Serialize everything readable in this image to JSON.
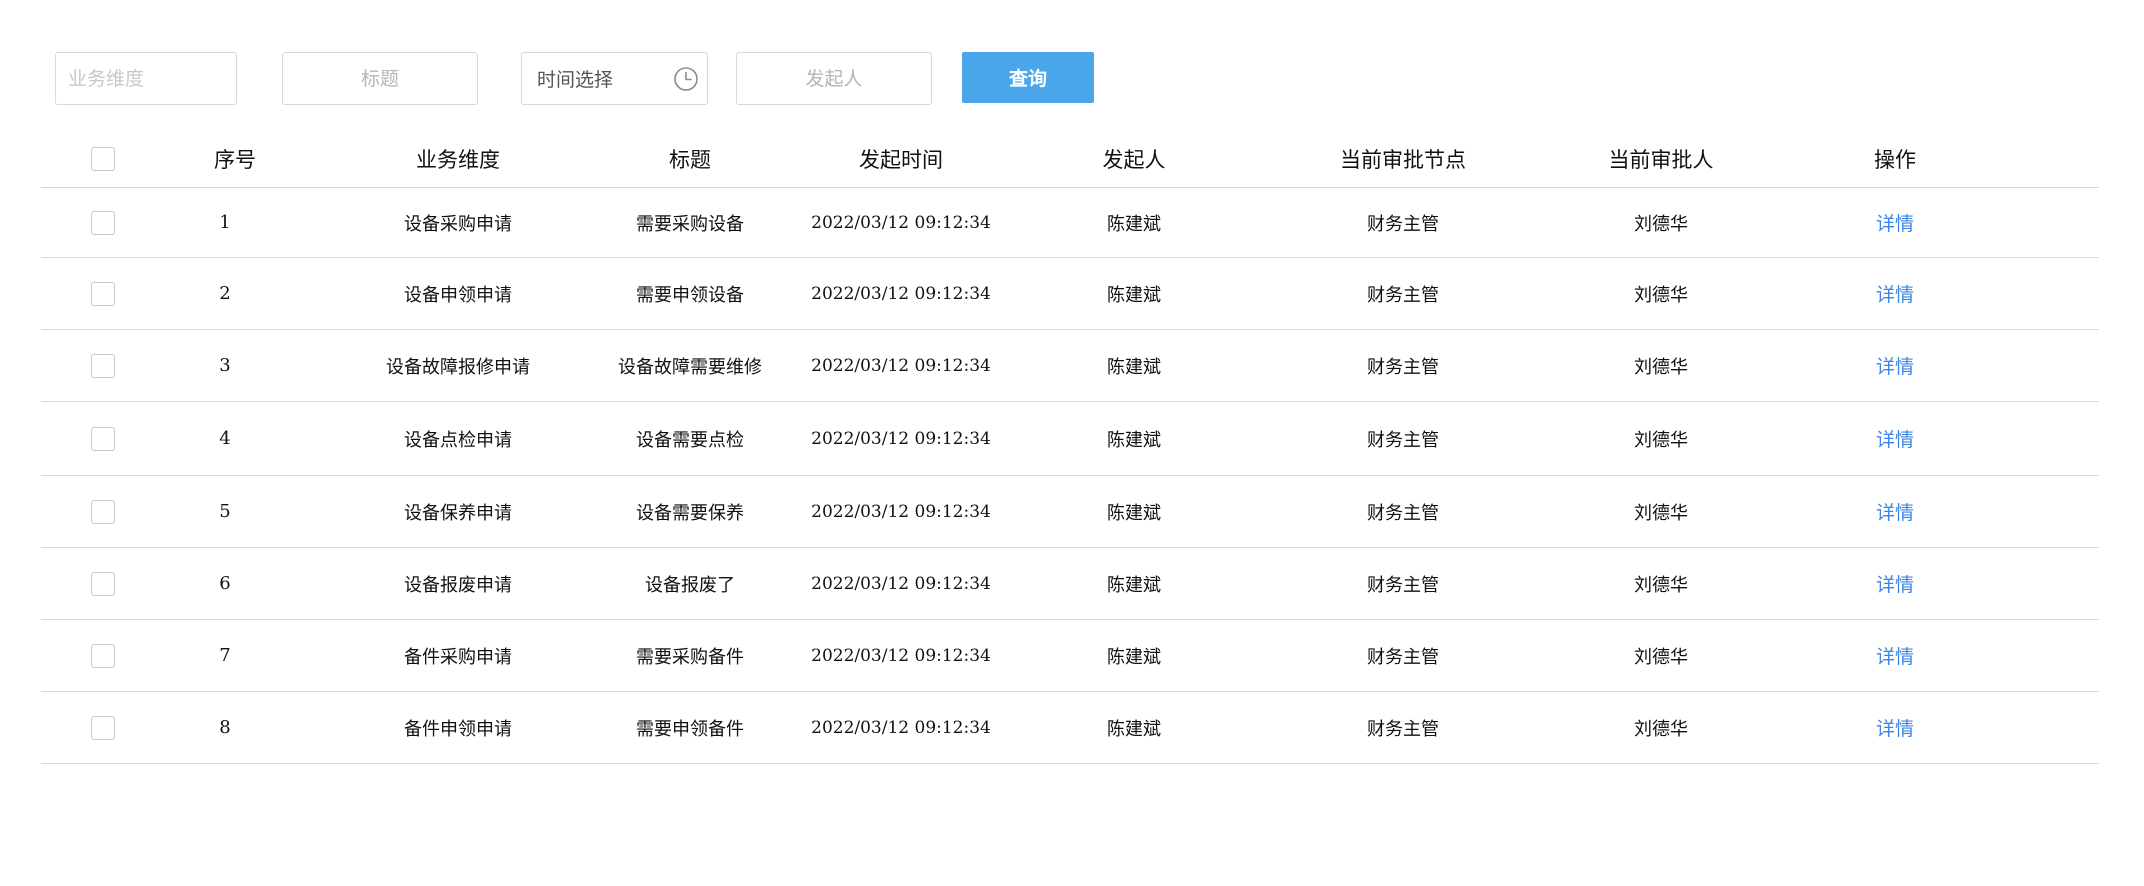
{
  "filters": {
    "dimension_placeholder": "业务维度",
    "title_placeholder": "标题",
    "time_label": "时间选择",
    "initiator_placeholder": "发起人",
    "query_label": "查询"
  },
  "table": {
    "columns": [
      "序号",
      "业务维度",
      "标题",
      "发起时间",
      "发起人",
      "当前审批节点",
      "当前审批人",
      "操作"
    ],
    "rows": [
      {
        "index": "1",
        "dimension": "设备采购申请",
        "title": "需要采购设备",
        "time": "2022/03/12 09:12:34",
        "initiator": "陈建斌",
        "node": "财务主管",
        "approver": "刘德华",
        "action": "详情"
      },
      {
        "index": "2",
        "dimension": "设备申领申请",
        "title": "需要申领设备",
        "time": "2022/03/12 09:12:34",
        "initiator": "陈建斌",
        "node": "财务主管",
        "approver": "刘德华",
        "action": "详情"
      },
      {
        "index": "3",
        "dimension": "设备故障报修申请",
        "title": "设备故障需要维修",
        "time": "2022/03/12 09:12:34",
        "initiator": "陈建斌",
        "node": "财务主管",
        "approver": "刘德华",
        "action": "详情"
      },
      {
        "index": "4",
        "dimension": "设备点检申请",
        "title": "设备需要点检",
        "time": "2022/03/12 09:12:34",
        "initiator": "陈建斌",
        "node": "财务主管",
        "approver": "刘德华",
        "action": "详情"
      },
      {
        "index": "5",
        "dimension": "设备保养申请",
        "title": "设备需要保养",
        "time": "2022/03/12 09:12:34",
        "initiator": "陈建斌",
        "node": "财务主管",
        "approver": "刘德华",
        "action": "详情"
      },
      {
        "index": "6",
        "dimension": "设备报废申请",
        "title": "设备报废了",
        "time": "2022/03/12 09:12:34",
        "initiator": "陈建斌",
        "node": "财务主管",
        "approver": "刘德华",
        "action": "详情"
      },
      {
        "index": "7",
        "dimension": "备件采购申请",
        "title": "需要采购备件",
        "time": "2022/03/12 09:12:34",
        "initiator": "陈建斌",
        "node": "财务主管",
        "approver": "刘德华",
        "action": "详情"
      },
      {
        "index": "8",
        "dimension": "备件申领申请",
        "title": "需要申领备件",
        "time": "2022/03/12 09:12:34",
        "initiator": "陈建斌",
        "node": "财务主管",
        "approver": "刘德华",
        "action": "详情"
      }
    ]
  },
  "colors": {
    "primary_button": "#4aa6ea",
    "link": "#3d85e6",
    "border": "#d9d9d9"
  },
  "icons": {
    "time": "clock-icon"
  }
}
